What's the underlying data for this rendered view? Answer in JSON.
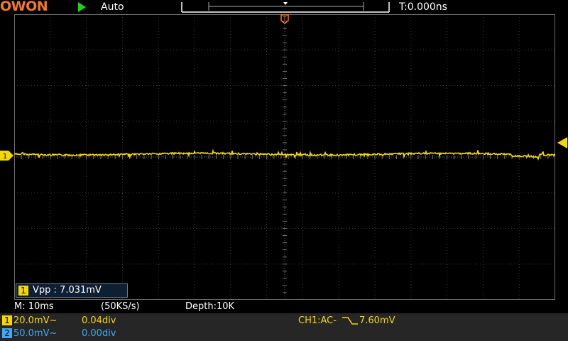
{
  "brand": {
    "logo": "OWON",
    "logo_color": "#f47a20"
  },
  "status": {
    "run_state_icon": "play-icon",
    "trigger_mode": "Auto",
    "time_offset": "T:0.000ns"
  },
  "measurement": {
    "channel": "1",
    "text": "Vpp : 7.031mV"
  },
  "acquisition": {
    "timebase": "M: 10ms",
    "sample_rate": "(50KS/s)",
    "depth": "Depth:10K"
  },
  "channels": [
    {
      "num": "1",
      "scale": "20.0mV~",
      "offset": "0.04div",
      "color": "#f4d800"
    },
    {
      "num": "2",
      "scale": "50.0mV~",
      "offset": "0.00div",
      "color": "#3fa9f5"
    }
  ],
  "trigger": {
    "source": "CH1:AC-",
    "edge_icon": "falling-edge-icon",
    "level": "7.60mV",
    "color": "#f4d800"
  },
  "colors": {
    "grid": "#3a3a3a",
    "grid_border": "#6e6e6e",
    "trace": "#f4d800",
    "background": "#000000"
  }
}
